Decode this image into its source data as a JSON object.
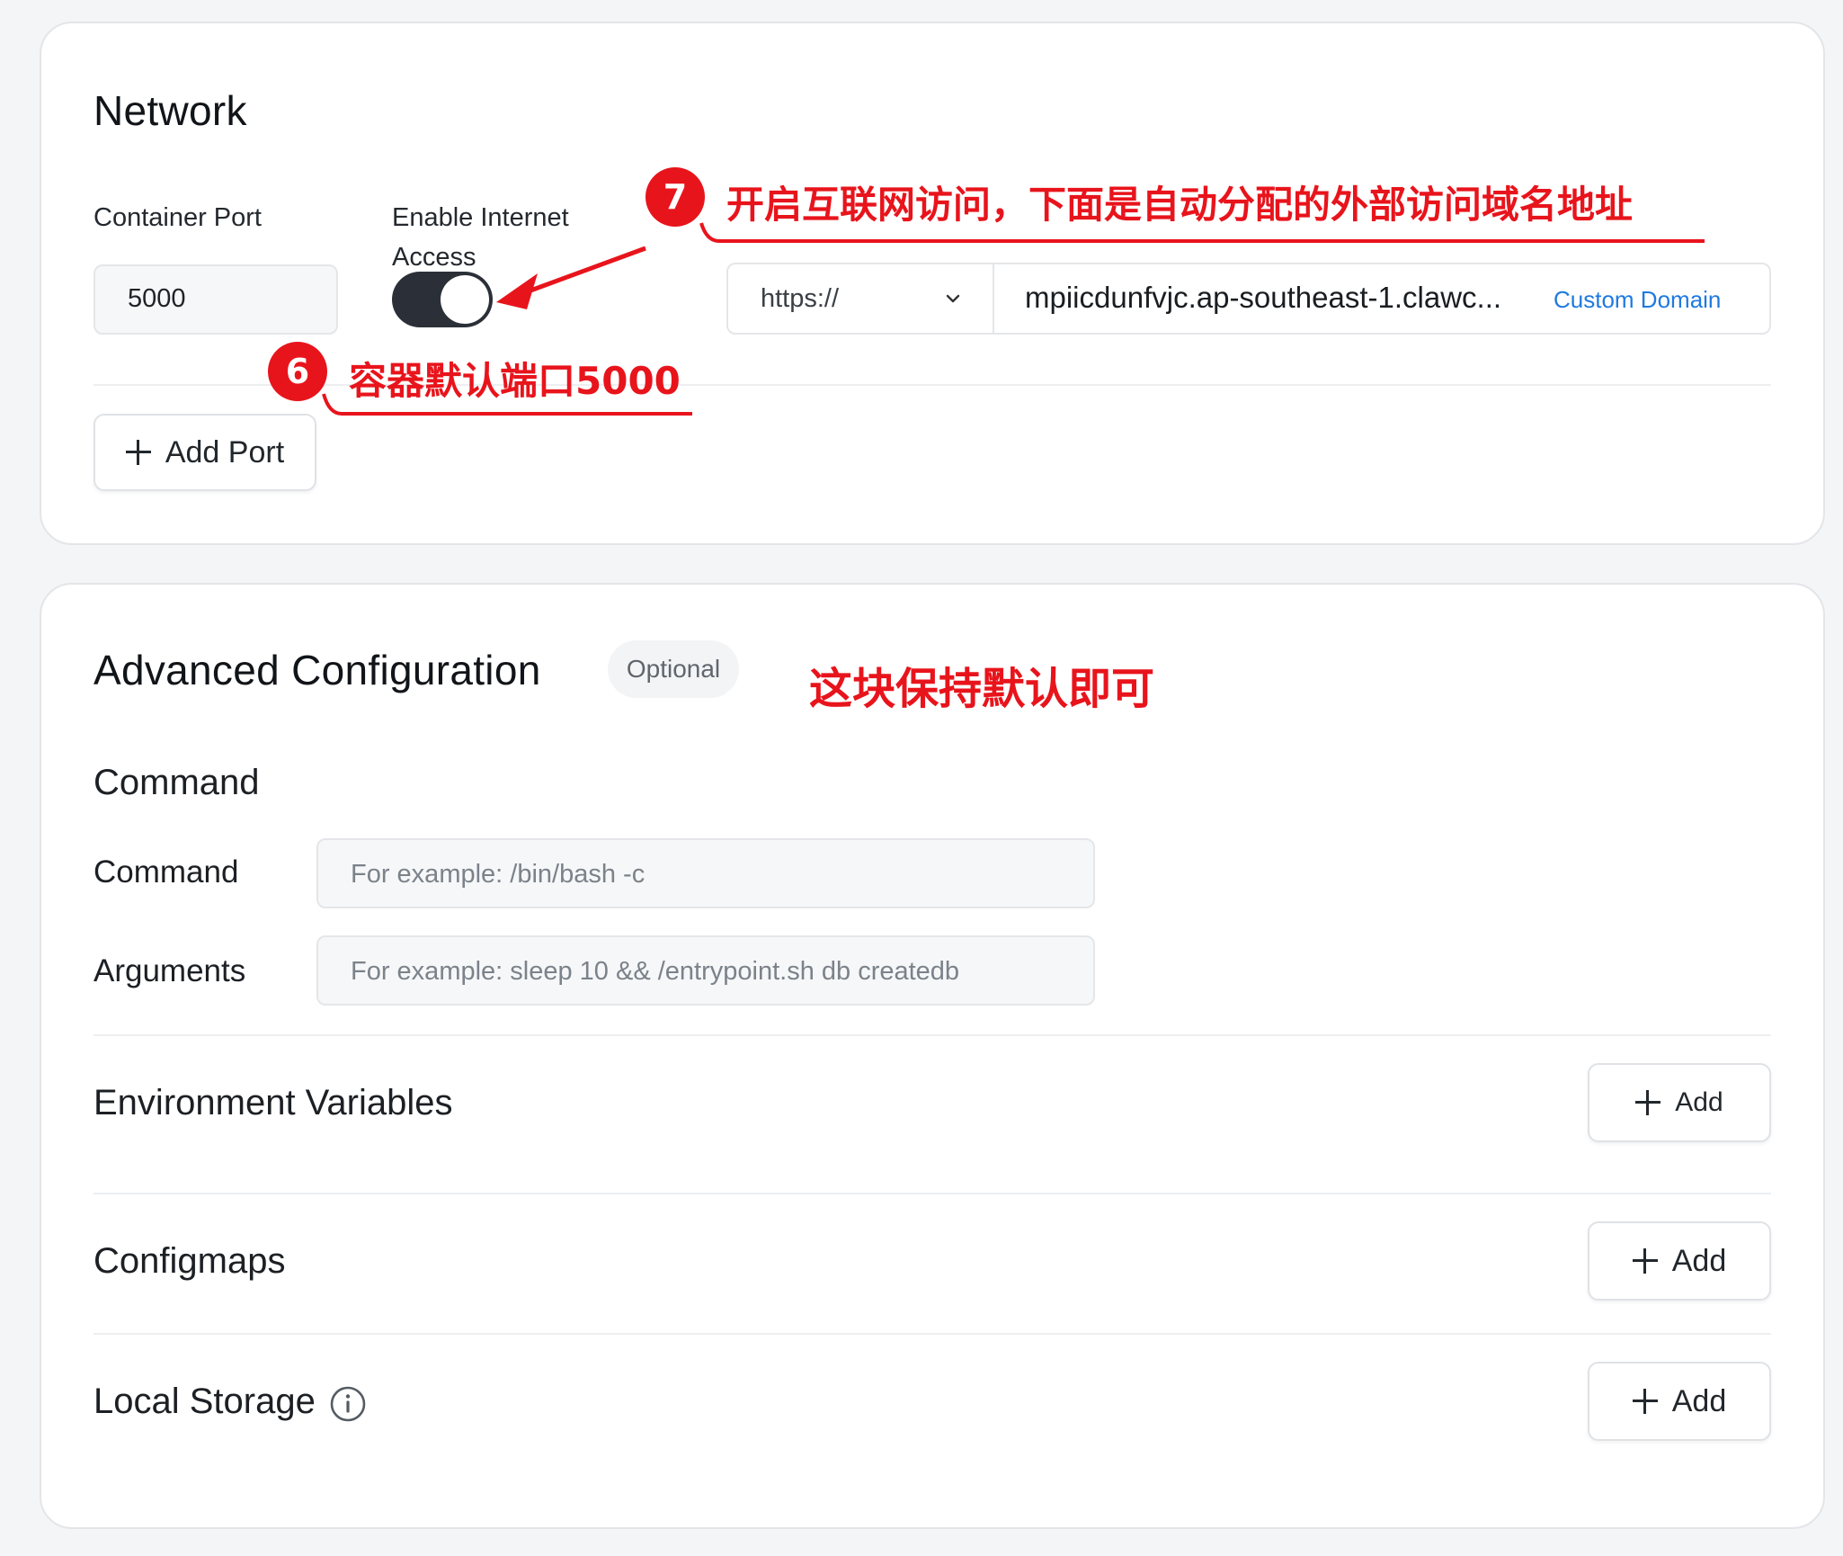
{
  "network": {
    "title": "Network",
    "container_port_label": "Container Port",
    "container_port_value": "5000",
    "enable_internet_label_line1": "Enable Internet",
    "enable_internet_label_line2": "Access",
    "internet_access_enabled": true,
    "protocol_select_value": "https://",
    "domain_value": "mpiicdunfvjc.ap-southeast-1.clawc...",
    "custom_domain_link": "Custom Domain",
    "add_port_label": "Add Port"
  },
  "advanced": {
    "title": "Advanced Configuration",
    "optional_badge": "Optional",
    "command_section_title": "Command",
    "command_label": "Command",
    "command_placeholder": "For example:  /bin/bash -c",
    "arguments_label": "Arguments",
    "arguments_placeholder": "For example:  sleep 10 && /entrypoint.sh db createdb",
    "env_title": "Environment Variables",
    "configmaps_title": "Configmaps",
    "local_storage_title": "Local Storage",
    "add_label": "Add"
  },
  "annotations": {
    "step7_number": "7",
    "step7_text": "开启互联网访问，下面是自动分配的外部访问域名地址",
    "step6_number": "6",
    "step6_text": "容器默认端口5000",
    "advanced_note": "这块保持默认即可",
    "color": "#e8141c"
  },
  "icons": {
    "plus": "plus-icon",
    "chevron": "chevron-down-icon",
    "info": "info-icon"
  }
}
